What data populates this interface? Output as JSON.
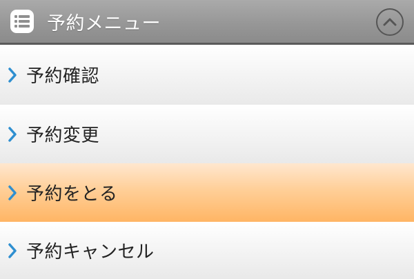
{
  "header": {
    "title": "予約メニュー",
    "menu_icon": "list-icon",
    "collapse_icon": "chevron-up-circle-icon"
  },
  "items": [
    {
      "label": "予約確認",
      "icon": "chevron-right-icon"
    },
    {
      "label": "予約変更",
      "icon": "chevron-right-icon"
    },
    {
      "label": "予約をとる",
      "icon": "chevron-right-icon",
      "highlighted": true
    },
    {
      "label": "予約キャンセル",
      "icon": "chevron-right-icon"
    }
  ],
  "colors": {
    "chevron": "#2f8fd0",
    "highlight": "#ffb564"
  }
}
